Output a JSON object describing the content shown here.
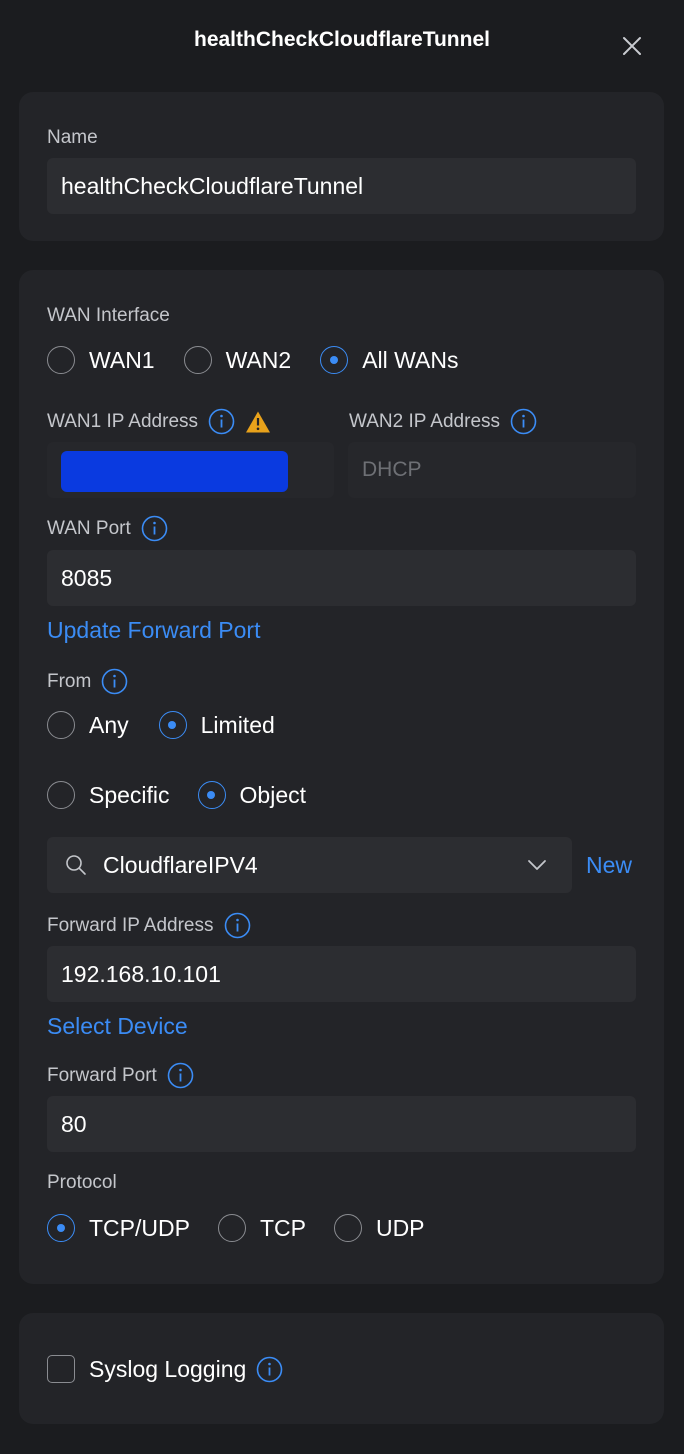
{
  "header": {
    "title": "healthCheckCloudflareTunnel"
  },
  "name_section": {
    "label": "Name",
    "value": "healthCheckCloudflareTunnel"
  },
  "wan_interface": {
    "label": "WAN Interface",
    "options": [
      "WAN1",
      "WAN2",
      "All WANs"
    ],
    "selected": "All WANs"
  },
  "wan1_ip": {
    "label": "WAN1 IP Address"
  },
  "wan2_ip": {
    "label": "WAN2 IP Address",
    "value": "DHCP"
  },
  "wan_port": {
    "label": "WAN Port",
    "value": "8085"
  },
  "update_forward_port_link": "Update Forward Port",
  "from": {
    "label": "From",
    "options": [
      "Any",
      "Limited"
    ],
    "selected": "Limited",
    "sub_options": [
      "Specific",
      "Object"
    ],
    "sub_selected": "Object"
  },
  "object_select": {
    "value": "CloudflareIPV4",
    "new_link": "New"
  },
  "forward_ip": {
    "label": "Forward IP Address",
    "value": "192.168.10.101"
  },
  "select_device_link": "Select Device",
  "forward_port": {
    "label": "Forward Port",
    "value": "80"
  },
  "protocol": {
    "label": "Protocol",
    "options": [
      "TCP/UDP",
      "TCP",
      "UDP"
    ],
    "selected": "TCP/UDP"
  },
  "syslog": {
    "label": "Syslog Logging",
    "checked": false
  },
  "colors": {
    "background": "#1b1c1f",
    "card": "#232428",
    "field": "#2c2d31",
    "accent": "#3b8cf5",
    "warning": "#e8a21b",
    "redacted": "#0a3ae0"
  },
  "icons": [
    "close-icon",
    "info-icon",
    "warning-icon",
    "search-icon",
    "chevron-down-icon"
  ]
}
